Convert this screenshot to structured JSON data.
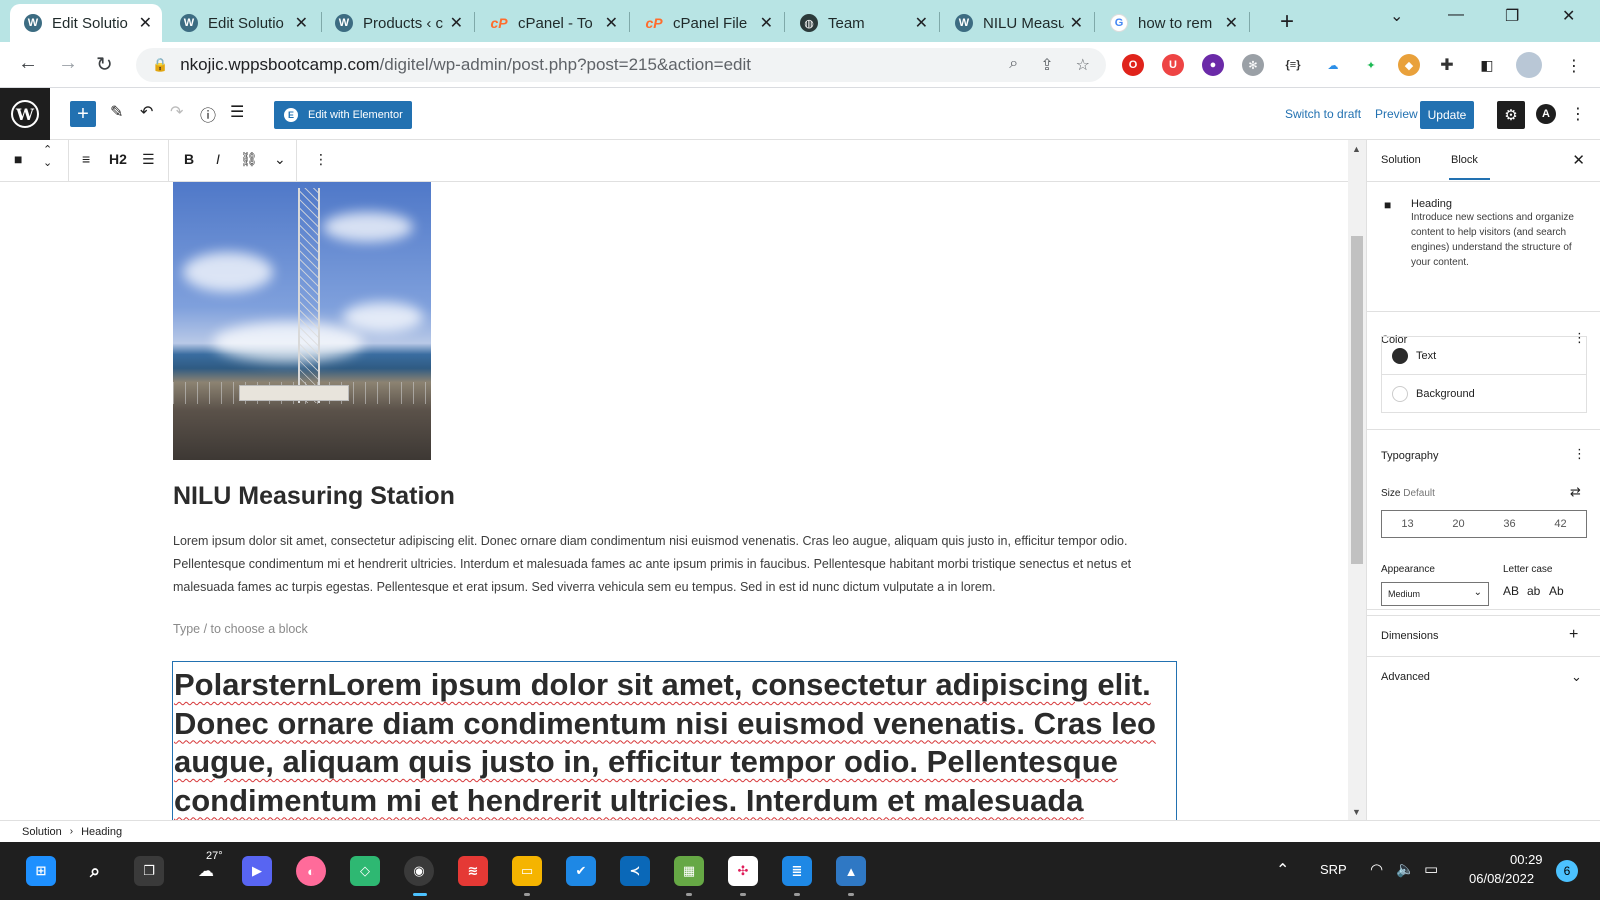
{
  "browser": {
    "tabs": [
      {
        "title": "Edit Solutio",
        "icon": "wordpress-icon",
        "active": true
      },
      {
        "title": "Edit Solutio",
        "icon": "wordpress-icon"
      },
      {
        "title": "Products ‹ c",
        "icon": "wordpress-icon"
      },
      {
        "title": "cPanel - To",
        "icon": "cpanel-icon"
      },
      {
        "title": "cPanel File",
        "icon": "cpanel-icon"
      },
      {
        "title": "Team",
        "icon": "globe-icon"
      },
      {
        "title": "NILU Measu",
        "icon": "wordpress-icon"
      },
      {
        "title": "how to rem",
        "icon": "google-icon"
      }
    ],
    "url_host": "nkojic.wppsbootcamp.com",
    "url_path": "/digitel/wp-admin/post.php?post=215&action=edit"
  },
  "editor": {
    "edit_elementor_label": "Edit with Elementor",
    "switch_draft_label": "Switch to draft",
    "preview_label": "Preview",
    "update_label": "Update",
    "block_level": "H2"
  },
  "content": {
    "image_alt": "NILU measuring station tower",
    "heading": "NILU Measuring Station",
    "paragraph": "Lorem ipsum dolor sit amet, consectetur adipiscing elit. Donec ornare diam condimentum nisi euismod venenatis. Cras leo augue, aliquam quis justo in, efficitur tempor odio. Pellentesque condimentum mi et hendrerit ultricies. Interdum et malesuada fames ac ante ipsum primis in faucibus. Pellentesque habitant morbi tristique senectus et netus et malesuada fames ac turpis egestas. Pellentesque et erat ipsum. Sed viverra vehicula sem eu tempus. Sed in est id nunc dictum vulputate a in lorem.",
    "block_placeholder": "Type / to choose a block",
    "selected_heading_lines": [
      "PolarsternLorem ipsum dolor sit amet, consectetur adipiscing elit.",
      "Donec ornare diam condimentum nisi euismod venenatis. Cras leo",
      "augue, aliquam quis justo in, efficitur tempor odio. Pellentesque",
      "condimentum mi et hendrerit ultricies. Interdum et malesuada fames"
    ]
  },
  "sidebar": {
    "tab_post": "Solution",
    "tab_block": "Block",
    "block_name": "Heading",
    "block_description": "Introduce new sections and organize content to help visitors (and search engines) understand the structure of your content.",
    "color_title": "Color",
    "color_text": "Text",
    "color_background": "Background",
    "typography_title": "Typography",
    "size_label": "Size",
    "size_value": "Default",
    "size_presets": [
      "13",
      "20",
      "36",
      "42"
    ],
    "appearance_label": "Appearance",
    "appearance_value": "Medium",
    "letter_case_label": "Letter case",
    "letter_cases": [
      "AB",
      "ab",
      "Ab"
    ],
    "dimensions_title": "Dimensions",
    "advanced_title": "Advanced"
  },
  "breadcrumb": {
    "root": "Solution",
    "current": "Heading"
  },
  "taskbar": {
    "weather": "27°",
    "language": "SRP",
    "time": "00:29",
    "date": "06/08/2022",
    "notifications": "6"
  },
  "colors": {
    "accent": "#2271b1",
    "tabstrip": "#b8e4e4",
    "taskbar": "#1f1f1f"
  }
}
